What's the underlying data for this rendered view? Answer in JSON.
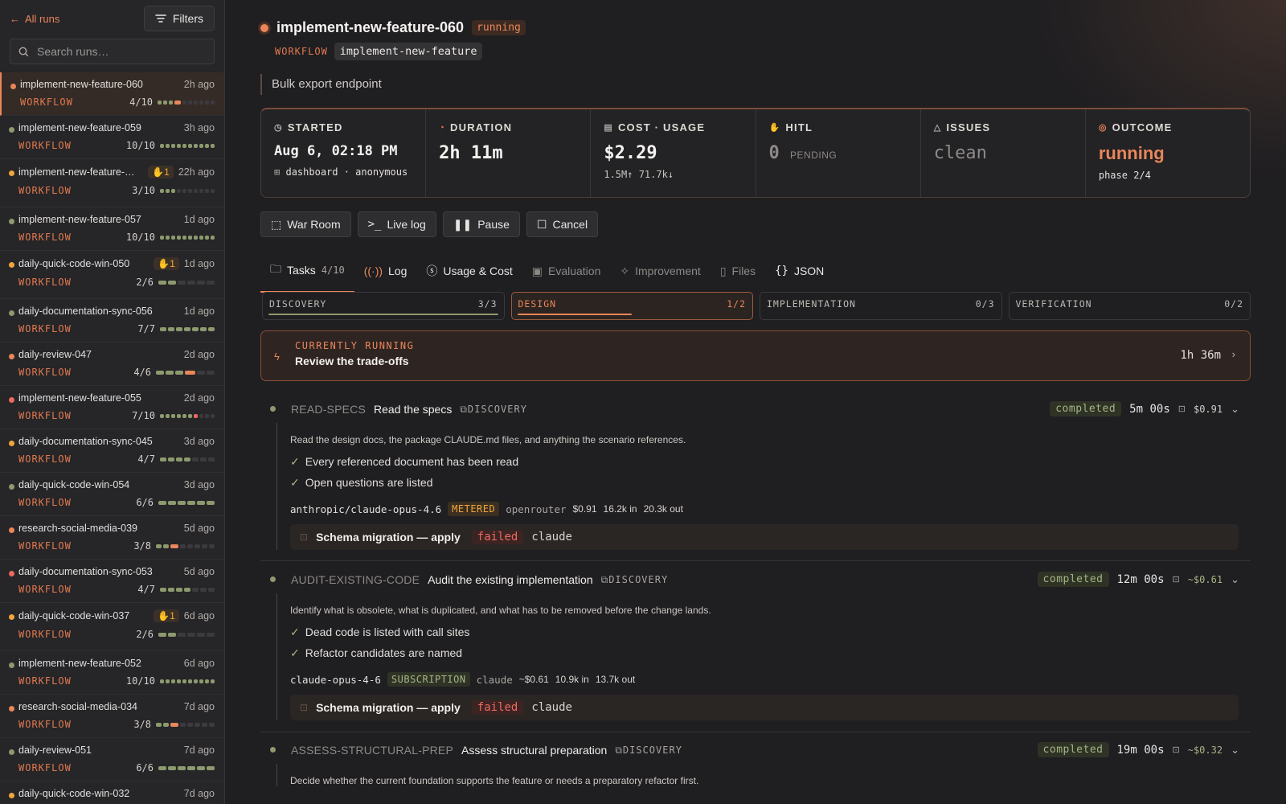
{
  "sidebar": {
    "all_runs": "All runs",
    "filters": "Filters",
    "search_placeholder": "Search runs…",
    "runs": [
      {
        "name": "implement-new-feature-060",
        "ago": "2h ago",
        "workflow": "WORKFLOW",
        "count": "4/10",
        "status": "running",
        "active": true,
        "progress": {
          "done": 4,
          "total": 10,
          "running": true
        }
      },
      {
        "name": "implement-new-feature-059",
        "ago": "3h ago",
        "workflow": "WORKFLOW",
        "count": "10/10",
        "status": "completed",
        "progress": {
          "done": 10,
          "total": 10
        }
      },
      {
        "name": "implement-new-feature-…",
        "ago": "22h ago",
        "workflow": "WORKFLOW",
        "count": "3/10",
        "status": "waiting",
        "hitl": "1",
        "progress": {
          "done": 3,
          "total": 10
        }
      },
      {
        "name": "implement-new-feature-057",
        "ago": "1d ago",
        "workflow": "WORKFLOW",
        "count": "10/10",
        "status": "completed",
        "progress": {
          "done": 10,
          "total": 10
        }
      },
      {
        "name": "daily-quick-code-win-050",
        "ago": "1d ago",
        "workflow": "WORKFLOW",
        "count": "2/6",
        "status": "waiting",
        "hitl": "1",
        "progress": {
          "done": 2,
          "total": 6
        }
      },
      {
        "name": "daily-documentation-sync-056",
        "ago": "1d ago",
        "workflow": "WORKFLOW",
        "count": "7/7",
        "status": "completed",
        "progress": {
          "done": 7,
          "total": 7
        }
      },
      {
        "name": "daily-review-047",
        "ago": "2d ago",
        "workflow": "WORKFLOW",
        "count": "4/6",
        "status": "running",
        "progress": {
          "done": 4,
          "total": 6,
          "running": true
        }
      },
      {
        "name": "implement-new-feature-055",
        "ago": "2d ago",
        "workflow": "WORKFLOW",
        "count": "7/10",
        "status": "failed",
        "progress": {
          "done": 7,
          "total": 10,
          "failed": true
        }
      },
      {
        "name": "daily-documentation-sync-045",
        "ago": "3d ago",
        "workflow": "WORKFLOW",
        "count": "4/7",
        "status": "waiting",
        "progress": {
          "done": 4,
          "total": 7
        }
      },
      {
        "name": "daily-quick-code-win-054",
        "ago": "3d ago",
        "workflow": "WORKFLOW",
        "count": "6/6",
        "status": "completed",
        "progress": {
          "done": 6,
          "total": 6
        }
      },
      {
        "name": "research-social-media-039",
        "ago": "5d ago",
        "workflow": "WORKFLOW",
        "count": "3/8",
        "status": "running",
        "progress": {
          "done": 3,
          "total": 8,
          "running": true
        }
      },
      {
        "name": "daily-documentation-sync-053",
        "ago": "5d ago",
        "workflow": "WORKFLOW",
        "count": "4/7",
        "status": "failed",
        "progress": {
          "done": 4,
          "total": 7
        }
      },
      {
        "name": "daily-quick-code-win-037",
        "ago": "6d ago",
        "workflow": "WORKFLOW",
        "count": "2/6",
        "status": "waiting",
        "hitl": "1",
        "progress": {
          "done": 2,
          "total": 6
        }
      },
      {
        "name": "implement-new-feature-052",
        "ago": "6d ago",
        "workflow": "WORKFLOW",
        "count": "10/10",
        "status": "completed",
        "progress": {
          "done": 10,
          "total": 10
        }
      },
      {
        "name": "research-social-media-034",
        "ago": "7d ago",
        "workflow": "WORKFLOW",
        "count": "3/8",
        "status": "running",
        "progress": {
          "done": 3,
          "total": 8,
          "running": true
        }
      },
      {
        "name": "daily-review-051",
        "ago": "7d ago",
        "workflow": "WORKFLOW",
        "count": "6/6",
        "status": "completed",
        "progress": {
          "done": 6,
          "total": 6
        }
      },
      {
        "name": "daily-quick-code-win-032",
        "ago": "7d ago",
        "workflow": "",
        "count": "",
        "status": "waiting",
        "progress": {
          "done": 0,
          "total": 0
        }
      }
    ]
  },
  "header": {
    "title": "implement-new-feature-060",
    "status": "running",
    "workflow_label": "WORKFLOW",
    "workflow": "implement-new-feature",
    "description": "Bulk export endpoint"
  },
  "stats": [
    {
      "label": "STARTED",
      "value": "Aug 6, 02:18 PM",
      "sub_user": "dashboard · anonymous",
      "icon": "clock-icon"
    },
    {
      "label": "DURATION",
      "value": "2h 11m",
      "icon": "timer-icon"
    },
    {
      "label": "COST · USAGE",
      "value": "$2.29",
      "sub": "1.5M↑ 71.7k↓",
      "icon": "receipt-icon"
    },
    {
      "label": "HITL",
      "value": "0",
      "sub": "PENDING",
      "icon": "hand-icon"
    },
    {
      "label": "ISSUES",
      "value": "clean",
      "icon": "warning-icon"
    },
    {
      "label": "OUTCOME",
      "value": "running",
      "sub": "phase 2/4",
      "icon": "target-icon"
    }
  ],
  "actions": {
    "war_room": "War Room",
    "live_log": "Live log",
    "pause": "Pause",
    "cancel": "Cancel"
  },
  "tabs": [
    {
      "label": "Tasks",
      "count": "4/10",
      "active": true
    },
    {
      "label": "Log"
    },
    {
      "label": "Usage & Cost"
    },
    {
      "label": "Evaluation"
    },
    {
      "label": "Improvement"
    },
    {
      "label": "Files"
    },
    {
      "label": "JSON"
    }
  ],
  "phases": [
    {
      "name": "DISCOVERY",
      "count": "3/3",
      "progress": 1.0
    },
    {
      "name": "DESIGN",
      "count": "1/2",
      "progress": 0.5,
      "active": true
    },
    {
      "name": "IMPLEMENTATION",
      "count": "0/3",
      "progress": 0
    },
    {
      "name": "VERIFICATION",
      "count": "0/2",
      "progress": 0
    }
  ],
  "current": {
    "label": "CURRENTLY RUNNING",
    "title": "Review the trade-offs",
    "time": "1h 36m"
  },
  "tasks": [
    {
      "id": "READ-SPECS",
      "name": "Read the specs",
      "phase": "DISCOVERY",
      "status": "completed",
      "duration": "5m 00s",
      "cost": "$0.91",
      "desc": "Read the design docs, the package CLAUDE.md files, and anything the scenario references.",
      "checks": [
        "Every referenced document has been read",
        "Open questions are listed"
      ],
      "model": "anthropic/claude-opus-4.6",
      "billing": "METERED",
      "provider": "openrouter",
      "mcost": "$0.91",
      "tin": "16.2k in",
      "tout": "20.3k out",
      "hitl": {
        "title": "Schema migration — apply",
        "status": "failed",
        "who": "claude"
      }
    },
    {
      "id": "AUDIT-EXISTING-CODE",
      "name": "Audit the existing implementation",
      "phase": "DISCOVERY",
      "status": "completed",
      "duration": "12m 00s",
      "cost": "~$0.61",
      "desc": "Identify what is obsolete, what is duplicated, and what has to be removed before the change lands.",
      "checks": [
        "Dead code is listed with call sites",
        "Refactor candidates are named"
      ],
      "model": "claude-opus-4-6",
      "billing": "SUBSCRIPTION",
      "provider": "claude",
      "mcost": "~$0.61",
      "tin": "10.9k in",
      "tout": "13.7k out",
      "hitl": {
        "title": "Schema migration — apply",
        "status": "failed",
        "who": "claude"
      }
    },
    {
      "id": "ASSESS-STRUCTURAL-PREP",
      "name": "Assess structural preparation",
      "phase": "DISCOVERY",
      "status": "completed",
      "duration": "19m 00s",
      "cost": "~$0.32",
      "desc": "Decide whether the current foundation supports the feature or needs a preparatory refactor first."
    }
  ],
  "colors": {
    "accent": "#e9865a",
    "completed": "#8d9a6e",
    "waiting": "#f0a63a",
    "failed": "#ec6a5e",
    "bg": "#1f1e21"
  }
}
